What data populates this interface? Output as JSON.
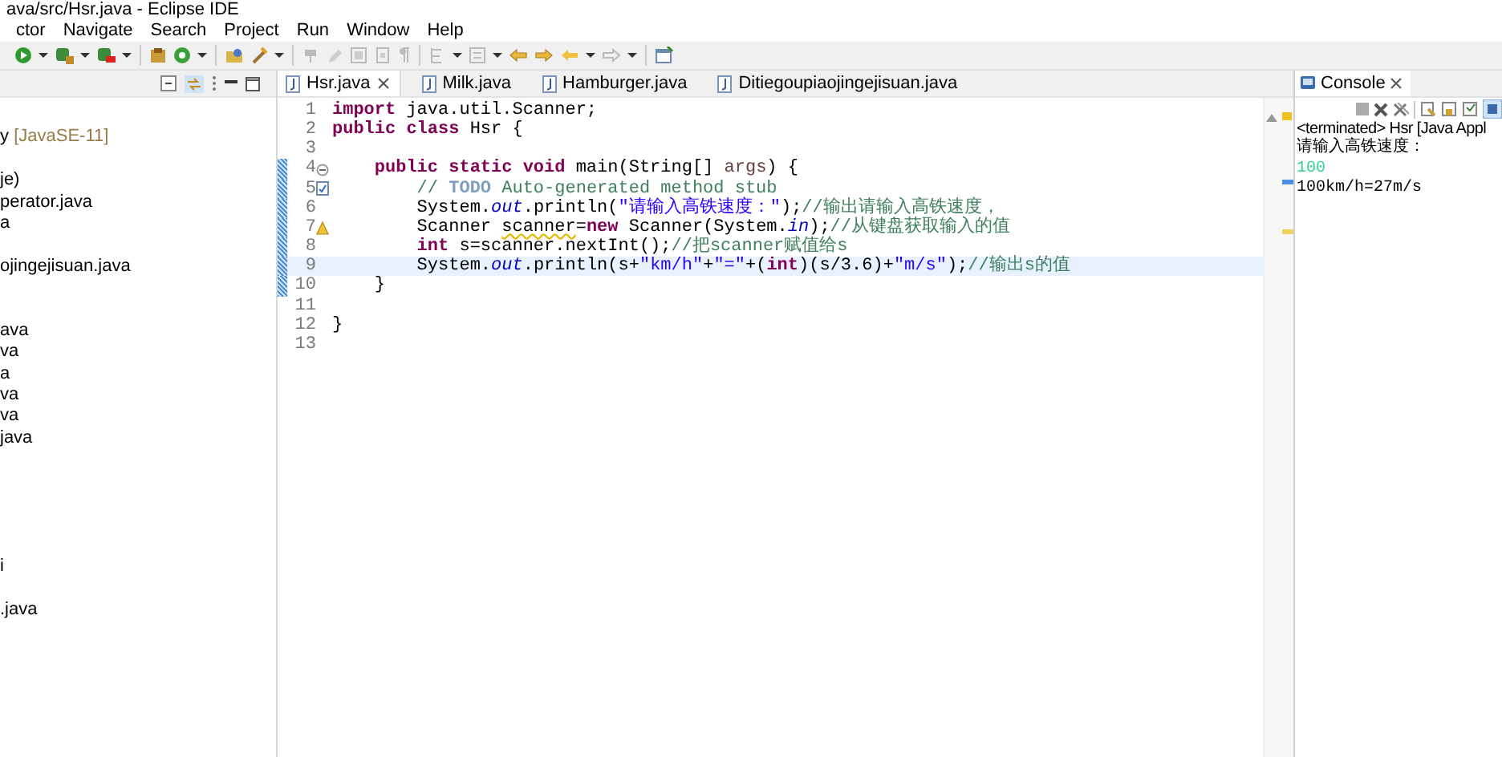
{
  "window": {
    "title": "ava/src/Hsr.java - Eclipse IDE"
  },
  "menu": [
    "ctor",
    "Navigate",
    "Search",
    "Project",
    "Run",
    "Window",
    "Help"
  ],
  "explorer": {
    "items": [
      {
        "kind": "blank"
      },
      {
        "kind": "item",
        "label": "y ",
        "decoration": "[JavaSE-11]"
      },
      {
        "kind": "blank"
      },
      {
        "kind": "item",
        "label": "je)"
      },
      {
        "kind": "item",
        "label": "perator.java"
      },
      {
        "kind": "item",
        "label": "a"
      },
      {
        "kind": "blank"
      },
      {
        "kind": "item",
        "label": "ojingejisuan.java"
      },
      {
        "kind": "blank"
      },
      {
        "kind": "blank"
      },
      {
        "kind": "item",
        "label": "ava"
      },
      {
        "kind": "item",
        "label": "va"
      },
      {
        "kind": "item",
        "label": "a"
      },
      {
        "kind": "item",
        "label": "va"
      },
      {
        "kind": "item",
        "label": "va"
      },
      {
        "kind": "item",
        "label": "java"
      },
      {
        "kind": "blank"
      },
      {
        "kind": "blank"
      },
      {
        "kind": "blank"
      },
      {
        "kind": "blank"
      },
      {
        "kind": "blank"
      },
      {
        "kind": "item",
        "label": "i"
      },
      {
        "kind": "blank"
      },
      {
        "kind": "item",
        "label": ".java"
      }
    ]
  },
  "editor": {
    "tabs": [
      {
        "label": "Hsr.java",
        "selected": true
      },
      {
        "label": "Milk.java",
        "selected": false
      },
      {
        "label": "Hamburger.java",
        "selected": false
      },
      {
        "label": "Ditiegoupiaojingejisuan.java",
        "selected": false
      }
    ],
    "lines": [
      {
        "number": "1",
        "current": false,
        "range": false,
        "tokens": [
          {
            "kind": "kw",
            "text": "import"
          },
          {
            "kind": "plain",
            "text": " java.util.Scanner;"
          }
        ]
      },
      {
        "number": "2",
        "current": false,
        "range": false,
        "tokens": [
          {
            "kind": "kw",
            "text": "public class"
          },
          {
            "kind": "plain",
            "text": " Hsr {"
          }
        ]
      },
      {
        "number": "3",
        "current": false,
        "range": false
      },
      {
        "number": "4",
        "current": false,
        "range": true,
        "marker": {
          "kind": "fold"
        },
        "tokens": [
          {
            "kind": "kw",
            "text": "    public static void"
          },
          {
            "kind": "plain",
            "text": " main(String[] "
          },
          {
            "kind": "param",
            "text": "args"
          },
          {
            "kind": "plain",
            "text": ") {"
          }
        ]
      },
      {
        "number": "5",
        "current": false,
        "range": true,
        "marker": {
          "kind": "task"
        },
        "tokens": [
          {
            "kind": "comment",
            "text": "        // "
          },
          {
            "kind": "todo",
            "text": "TODO"
          },
          {
            "kind": "comment",
            "text": " Auto-generated method stub"
          }
        ]
      },
      {
        "number": "6",
        "current": false,
        "range": true,
        "tokens": [
          {
            "kind": "plain",
            "text": "        System."
          },
          {
            "kind": "field",
            "text": "out"
          },
          {
            "kind": "plain",
            "text": ".println("
          },
          {
            "kind": "str",
            "text": "\"请输入高铁速度：\""
          },
          {
            "kind": "plain",
            "text": ");"
          },
          {
            "kind": "comment",
            "text": "//输出请输入高铁速度，"
          }
        ]
      },
      {
        "number": "7",
        "current": false,
        "range": true,
        "marker": {
          "kind": "warning"
        },
        "tokens": [
          {
            "kind": "plain",
            "text": "        Scanner "
          },
          {
            "kind": "warn",
            "text": "scanner"
          },
          {
            "kind": "plain",
            "text": "="
          },
          {
            "kind": "kw",
            "text": "new"
          },
          {
            "kind": "plain",
            "text": " Scanner(System."
          },
          {
            "kind": "field",
            "text": "in"
          },
          {
            "kind": "plain",
            "text": ");"
          },
          {
            "kind": "comment",
            "text": "//从键盘获取输入的值"
          }
        ]
      },
      {
        "number": "8",
        "current": false,
        "range": true,
        "tokens": [
          {
            "kind": "kw",
            "text": "        int"
          },
          {
            "kind": "plain",
            "text": " s=scanner.nextInt();"
          },
          {
            "kind": "comment",
            "text": "//把scanner赋值给s"
          }
        ]
      },
      {
        "number": "9",
        "current": true,
        "range": true,
        "tokens": [
          {
            "kind": "plain",
            "text": "        System."
          },
          {
            "kind": "field",
            "text": "out"
          },
          {
            "kind": "plain",
            "text": ".println(s+"
          },
          {
            "kind": "str",
            "text": "\"km/h\""
          },
          {
            "kind": "plain",
            "text": "+"
          },
          {
            "kind": "str",
            "text": "\"=\""
          },
          {
            "kind": "plain",
            "text": "+("
          },
          {
            "kind": "kw",
            "text": "int"
          },
          {
            "kind": "plain",
            "text": ")(s/3.6)+"
          },
          {
            "kind": "str",
            "text": "\"m/s\""
          },
          {
            "kind": "plain",
            "text": ");"
          },
          {
            "kind": "comment",
            "text": "//输出s的值"
          }
        ]
      },
      {
        "number": "10",
        "current": false,
        "range": true,
        "tokens": [
          {
            "kind": "plain",
            "text": "    }"
          }
        ]
      },
      {
        "number": "11",
        "current": false,
        "range": false
      },
      {
        "number": "12",
        "current": false,
        "range": false,
        "tokens": [
          {
            "kind": "plain",
            "text": "}"
          }
        ]
      },
      {
        "number": "13",
        "current": false,
        "range": false
      }
    ]
  },
  "console": {
    "tab": {
      "label": "Console",
      "selected": true
    },
    "header": "<terminated> Hsr [Java Appl",
    "lines": [
      {
        "kind": "out",
        "text": "请输入高铁速度："
      },
      {
        "kind": "in",
        "text": "100"
      },
      {
        "kind": "out",
        "text": "100km/h=27m/s"
      }
    ]
  }
}
